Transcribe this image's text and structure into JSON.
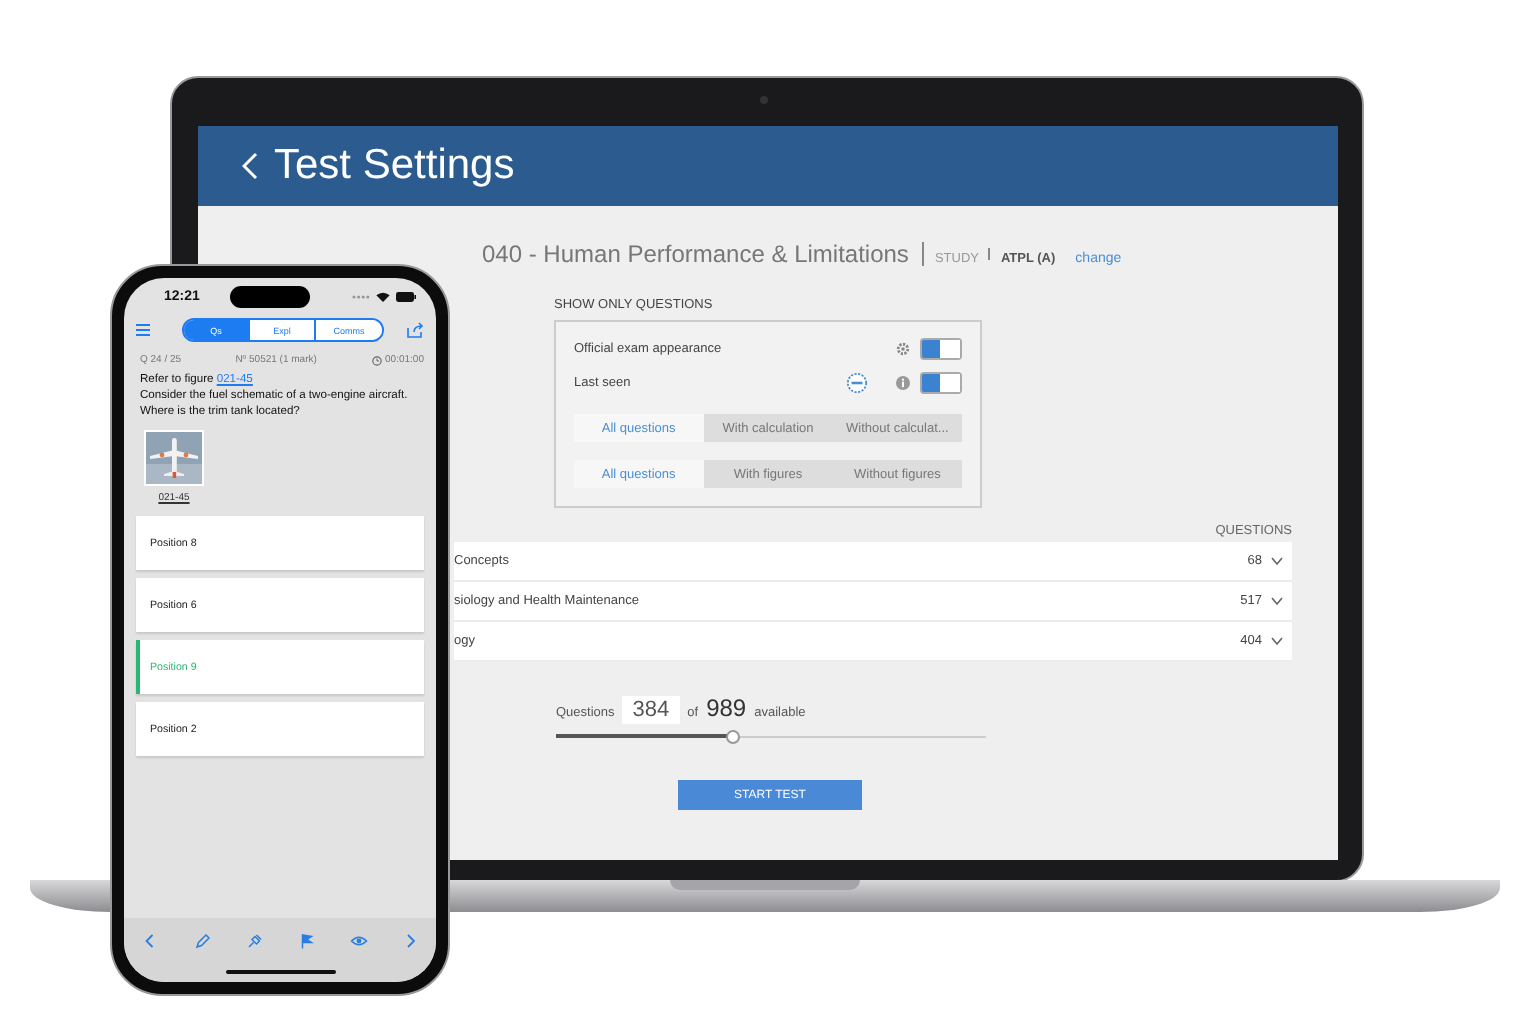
{
  "laptop": {
    "header_title": "Test Settings",
    "subject": "040 - Human Performance & Limitations",
    "mode": "STUDY",
    "licence": "ATPL (A)",
    "change_link": "change",
    "filter_heading": "SHOW ONLY QUESTIONS",
    "toggles": [
      {
        "label": "Official exam appearance",
        "on": true,
        "kind": "settings"
      },
      {
        "label": "Last seen",
        "on": true,
        "kind": "new"
      }
    ],
    "segment_groups": [
      [
        {
          "label": "All questions",
          "selected": true
        },
        {
          "label": "With calculation",
          "selected": false
        },
        {
          "label": "Without calculat...",
          "selected": false
        }
      ],
      [
        {
          "label": "All questions",
          "selected": true
        },
        {
          "label": "With figures",
          "selected": false
        },
        {
          "label": "Without figures",
          "selected": false
        }
      ]
    ],
    "questions_header": "QUESTIONS",
    "topics": [
      {
        "name": "Concepts",
        "count": "68"
      },
      {
        "name": "siology and Health Maintenance",
        "count": "517"
      },
      {
        "name": "ogy",
        "count": "404"
      }
    ],
    "count_label": "Questions",
    "count_value": "384",
    "count_of": "of",
    "count_total": "989",
    "count_suffix": "available",
    "slider": {
      "level": 0.41
    },
    "start_button": "START TEST"
  },
  "phone": {
    "time": "12:21",
    "tabs": [
      {
        "label": "Qs",
        "selected": true
      },
      {
        "label": "Expl",
        "selected": false
      },
      {
        "label": "Comms",
        "selected": false
      }
    ],
    "question_number": "Q 24 / 25",
    "question_id": "Nº 50521 (1 mark)",
    "timer": "00:01:00",
    "question_intro": "Refer to figure",
    "figure_link": "021-45",
    "question_text": "Consider the fuel schematic of a two-engine aircraft. Where is the trim tank located?",
    "figure_caption": "021-45",
    "answers": [
      {
        "label": "Position 8",
        "selected": false
      },
      {
        "label": "Position 6",
        "selected": false
      },
      {
        "label": "Position 9",
        "selected": true
      },
      {
        "label": "Position 2",
        "selected": false
      }
    ]
  }
}
